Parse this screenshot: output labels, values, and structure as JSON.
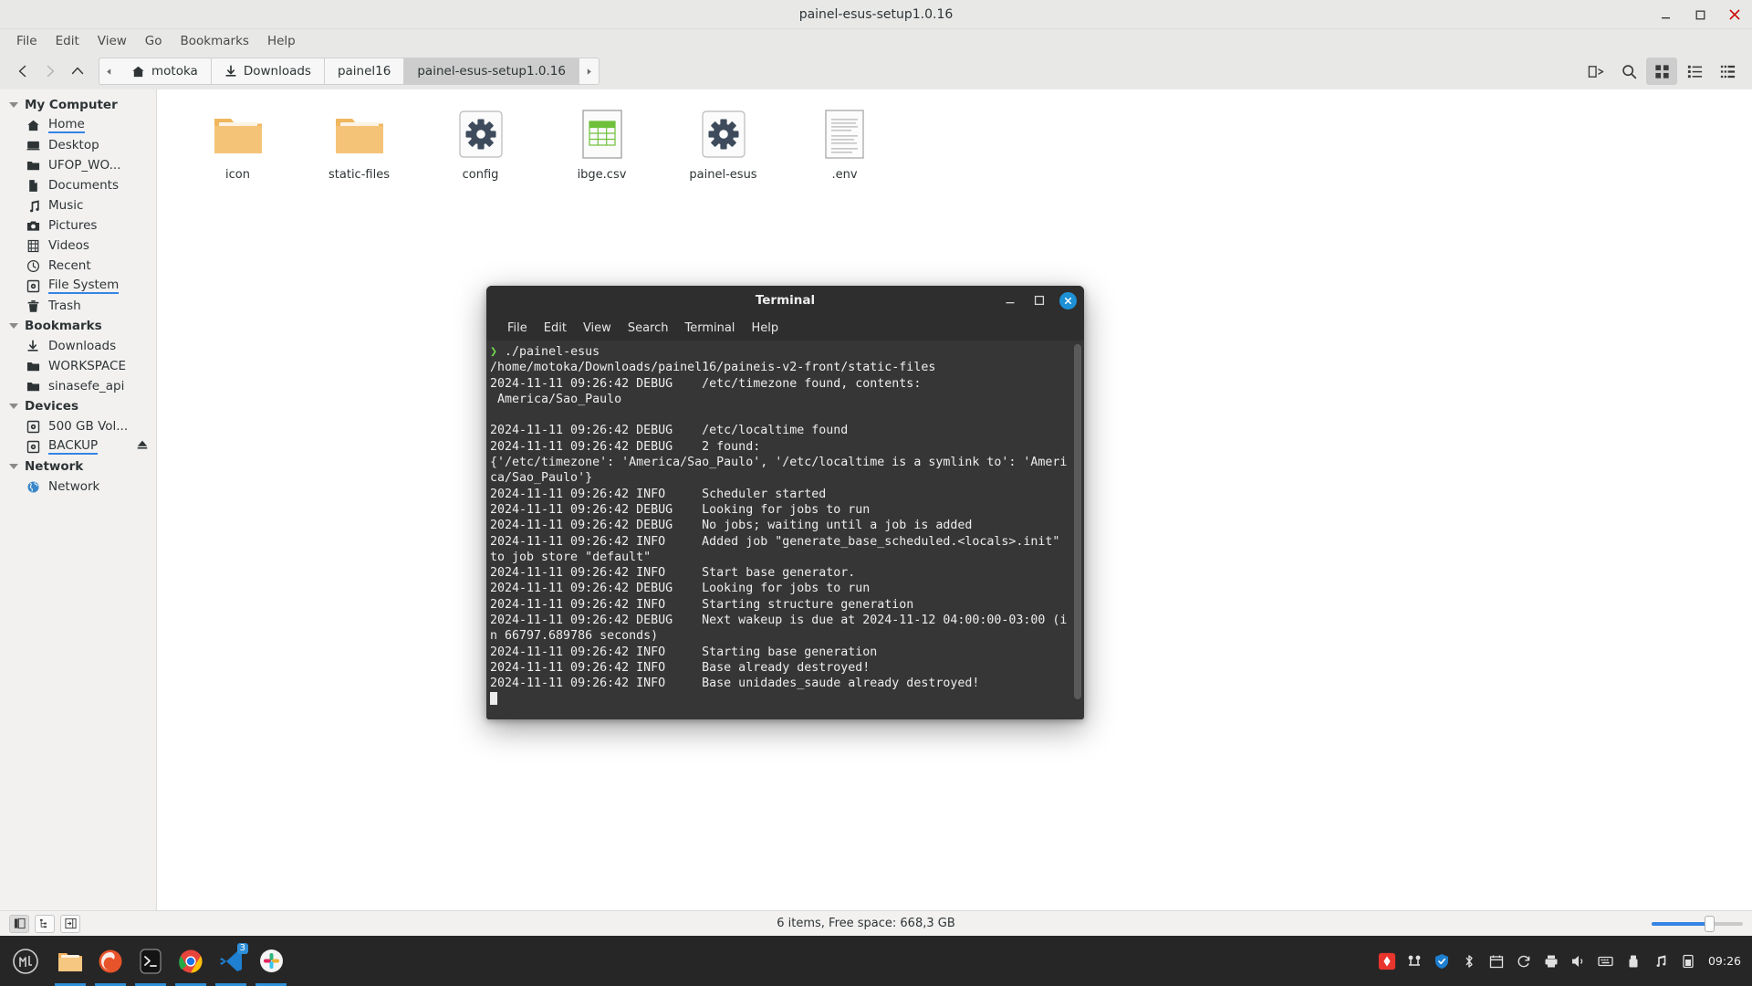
{
  "window": {
    "title": "painel-esus-setup1.0.16",
    "minimize_icon": "minimize-icon",
    "maximize_icon": "maximize-icon",
    "close_icon": "close-icon"
  },
  "menubar": {
    "items": [
      {
        "label": "File"
      },
      {
        "label": "Edit"
      },
      {
        "label": "View"
      },
      {
        "label": "Go"
      },
      {
        "label": "Bookmarks"
      },
      {
        "label": "Help"
      }
    ]
  },
  "toolbar": {
    "back_icon": "chevron-left-icon",
    "forward_icon": "chevron-right-icon",
    "up_icon": "chevron-up-icon",
    "breadcrumb_scroll_left_icon": "triangle-left-icon",
    "breadcrumb_scroll_right_icon": "triangle-right-icon",
    "breadcrumbs": [
      {
        "label": "motoka",
        "icon": "home-icon",
        "active": false
      },
      {
        "label": "Downloads",
        "icon": "download-arrow-icon",
        "active": false
      },
      {
        "label": "painel16",
        "icon": "",
        "active": false
      },
      {
        "label": "painel-esus-setup1.0.16",
        "icon": "",
        "active": true
      }
    ],
    "right_buttons": [
      {
        "name": "split-view-icon"
      },
      {
        "name": "search-icon"
      },
      {
        "name": "icon-view-icon",
        "selected": true
      },
      {
        "name": "list-view-icon",
        "selected": false
      },
      {
        "name": "compact-view-icon",
        "selected": false
      }
    ]
  },
  "sidebar": {
    "groups": [
      {
        "label": "My Computer",
        "items": [
          {
            "label": "Home",
            "icon": "home-icon",
            "link": true,
            "selected": true
          },
          {
            "label": "Desktop",
            "icon": "desktop-icon",
            "link": false
          },
          {
            "label": "UFOP_WO...",
            "icon": "folder-icon",
            "link": false
          },
          {
            "label": "Documents",
            "icon": "document-icon",
            "link": false
          },
          {
            "label": "Music",
            "icon": "music-note-icon",
            "link": false
          },
          {
            "label": "Pictures",
            "icon": "camera-icon",
            "link": false
          },
          {
            "label": "Videos",
            "icon": "film-icon",
            "link": false
          },
          {
            "label": "Recent",
            "icon": "clock-icon",
            "link": false
          },
          {
            "label": "File System",
            "icon": "drive-icon",
            "link": true,
            "selected": true
          },
          {
            "label": "Trash",
            "icon": "trash-icon",
            "link": false
          }
        ]
      },
      {
        "label": "Bookmarks",
        "items": [
          {
            "label": "Downloads",
            "icon": "download-arrow-icon",
            "link": false
          },
          {
            "label": "WORKSPACE",
            "icon": "folder-icon",
            "link": false
          },
          {
            "label": "sinasefe_api",
            "icon": "folder-icon",
            "link": false
          }
        ]
      },
      {
        "label": "Devices",
        "items": [
          {
            "label": "500 GB Vol...",
            "icon": "drive-icon",
            "link": false
          },
          {
            "label": "BACKUP",
            "icon": "drive-icon",
            "link": true,
            "selected": true,
            "eject": "eject-icon"
          }
        ]
      },
      {
        "label": "Network",
        "items": [
          {
            "label": "Network",
            "icon": "globe-icon",
            "link": false
          }
        ]
      }
    ]
  },
  "files": [
    {
      "label": "icon",
      "type": "folder"
    },
    {
      "label": "static-files",
      "type": "folder"
    },
    {
      "label": "config",
      "type": "executable"
    },
    {
      "label": "ibge.csv",
      "type": "spreadsheet"
    },
    {
      "label": "painel-esus",
      "type": "executable"
    },
    {
      "label": ".env",
      "type": "text"
    }
  ],
  "statusbar": {
    "tools": [
      {
        "name": "sidebar-toggle-icon",
        "active": true
      },
      {
        "name": "tree-view-icon",
        "active": false
      },
      {
        "name": "preview-pane-icon",
        "active": false
      }
    ],
    "status": "6 items, Free space: 668,3 GB",
    "zoom_slider": "zoom-slider"
  },
  "terminal": {
    "title": "Terminal",
    "minimize_icon": "minimize-icon",
    "maximize_icon": "maximize-icon",
    "close_icon": "close-icon",
    "menu": [
      {
        "label": "File"
      },
      {
        "label": "Edit"
      },
      {
        "label": "View"
      },
      {
        "label": "Search"
      },
      {
        "label": "Terminal"
      },
      {
        "label": "Help"
      }
    ],
    "prompt_glyph": "❯",
    "command": "./painel-esus",
    "output": "/home/motoka/Downloads/painel16/paineis-v2-front/static-files\n2024-11-11 09:26:42 DEBUG    /etc/timezone found, contents:\n America/Sao_Paulo\n\n2024-11-11 09:26:42 DEBUG    /etc/localtime found\n2024-11-11 09:26:42 DEBUG    2 found:\n{'/etc/timezone': 'America/Sao_Paulo', '/etc/localtime is a symlink to': 'America/Sao_Paulo'}\n2024-11-11 09:26:42 INFO     Scheduler started\n2024-11-11 09:26:42 DEBUG    Looking for jobs to run\n2024-11-11 09:26:42 DEBUG    No jobs; waiting until a job is added\n2024-11-11 09:26:42 INFO     Added job \"generate_base_scheduled.<locals>.init\" to job store \"default\"\n2024-11-11 09:26:42 INFO     Start base generator.\n2024-11-11 09:26:42 DEBUG    Looking for jobs to run\n2024-11-11 09:26:42 INFO     Starting structure generation\n2024-11-11 09:26:42 DEBUG    Next wakeup is due at 2024-11-12 04:00:00-03:00 (in 66797.689786 seconds)\n2024-11-11 09:26:42 INFO     Starting base generation\n2024-11-11 09:26:42 INFO     Base already destroyed!\n2024-11-11 09:26:42 INFO     Base unidades_saude already destroyed!\n"
  },
  "taskbar": {
    "start_icon": "start-menu-icon",
    "apps": [
      {
        "name": "file-manager-icon",
        "running": true
      },
      {
        "name": "firefox-icon",
        "running": true,
        "badge": ""
      },
      {
        "name": "terminal-icon",
        "running": true,
        "badge": ""
      },
      {
        "name": "chrome-icon",
        "running": true,
        "badge": ""
      },
      {
        "name": "vscode-icon",
        "running": true,
        "badge": "3"
      },
      {
        "name": "slack-icon",
        "running": true,
        "badge": ""
      }
    ],
    "tray": [
      {
        "name": "notification-icon"
      },
      {
        "name": "network-icon"
      },
      {
        "name": "shield-icon"
      },
      {
        "name": "bluetooth-icon"
      },
      {
        "name": "calendar-icon"
      },
      {
        "name": "update-icon"
      },
      {
        "name": "printer-icon"
      },
      {
        "name": "volume-icon"
      },
      {
        "name": "keyboard-icon"
      },
      {
        "name": "usb-icon"
      },
      {
        "name": "music-icon"
      },
      {
        "name": "battery-icon"
      }
    ],
    "clock": "09:26"
  }
}
